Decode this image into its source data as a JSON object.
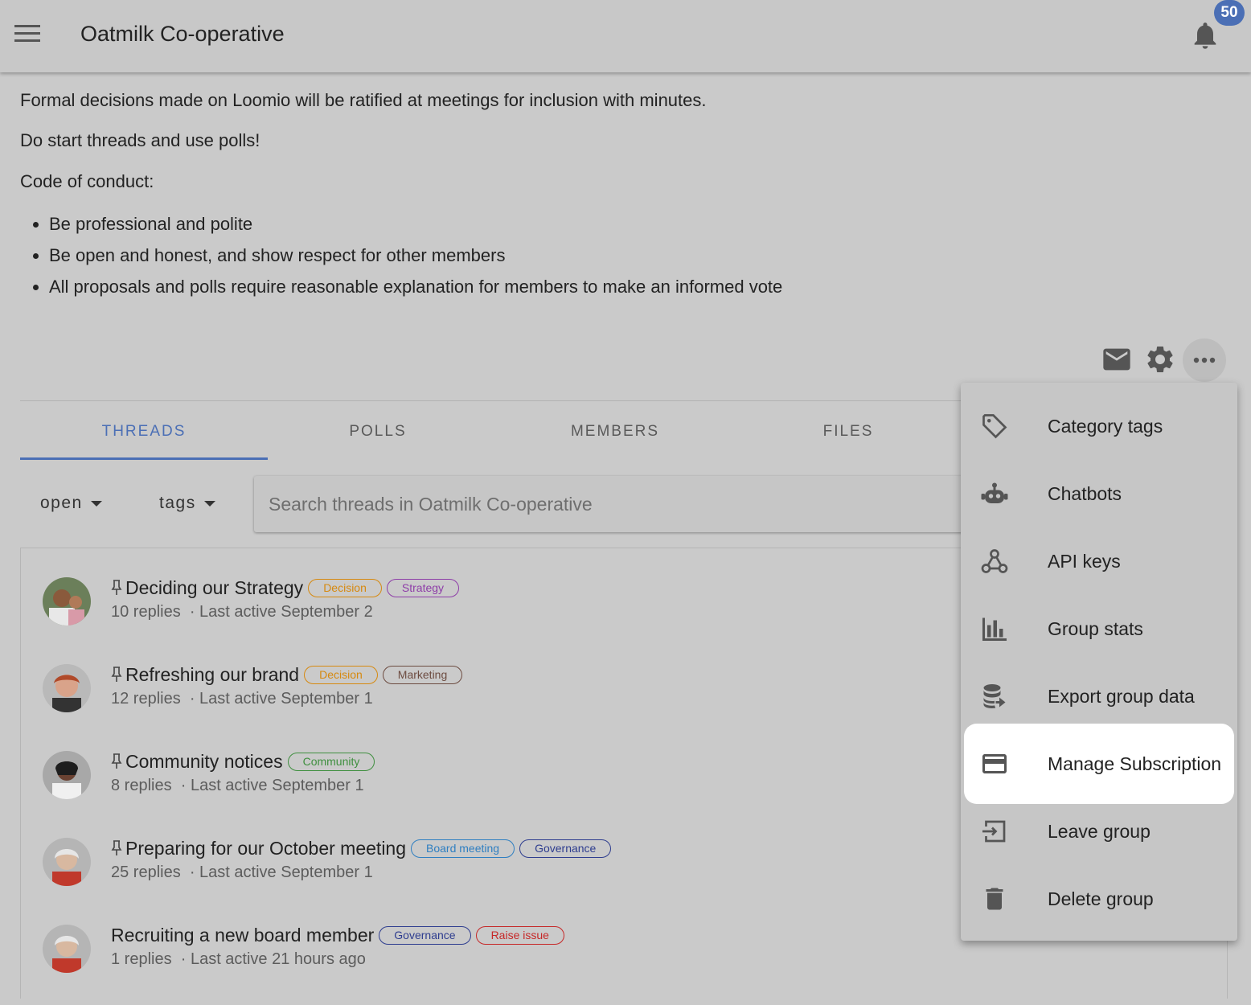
{
  "header": {
    "title": "Oatmilk Co-operative",
    "notification_count": "50"
  },
  "description": {
    "p1": "Formal decisions made on Loomio will be ratified at meetings for inclusion with minutes.",
    "p2": "Do start threads and use polls!",
    "p3": "Code of conduct:",
    "bullets": [
      "Be professional and polite",
      "Be open and honest, and show respect for other members",
      "All proposals and polls require reasonable explanation for members to make an informed vote"
    ]
  },
  "tabs": [
    "THREADS",
    "POLLS",
    "MEMBERS",
    "FILES"
  ],
  "filters": {
    "status": "open",
    "tags": "tags"
  },
  "search": {
    "placeholder": "Search threads in Oatmilk Co-operative"
  },
  "threads": [
    {
      "title": "Deciding our Strategy",
      "pinned": true,
      "tags": [
        {
          "label": "Decision",
          "color": "#d68910"
        },
        {
          "label": "Strategy",
          "color": "#8e3ea8"
        }
      ],
      "replies": "10 replies",
      "last_active": "· Last active September 2"
    },
    {
      "title": "Refreshing our brand",
      "pinned": true,
      "tags": [
        {
          "label": "Decision",
          "color": "#d68910"
        },
        {
          "label": "Marketing",
          "color": "#6d4c41"
        }
      ],
      "replies": "12 replies",
      "last_active": "· Last active September 1"
    },
    {
      "title": "Community notices",
      "pinned": true,
      "tags": [
        {
          "label": "Community",
          "color": "#3f8f3f"
        }
      ],
      "replies": "8 replies",
      "last_active": "· Last active September 1"
    },
    {
      "title": "Preparing for our October meeting",
      "pinned": true,
      "tags": [
        {
          "label": "Board meeting",
          "color": "#2f7fc1"
        },
        {
          "label": "Governance",
          "color": "#2e3d8f"
        }
      ],
      "replies": "25 replies",
      "last_active": "· Last active September 1"
    },
    {
      "title": "Recruiting a new board member",
      "pinned": false,
      "tags": [
        {
          "label": "Governance",
          "color": "#2e3d8f"
        },
        {
          "label": "Raise issue",
          "color": "#c62828"
        }
      ],
      "replies": "1 replies",
      "last_active": "· Last active 21 hours ago"
    }
  ],
  "menu": {
    "items": [
      {
        "label": "Category tags",
        "icon": "tag-icon"
      },
      {
        "label": "Chatbots",
        "icon": "robot-icon"
      },
      {
        "label": "API keys",
        "icon": "webhook-icon"
      },
      {
        "label": "Group stats",
        "icon": "bar-chart-icon"
      },
      {
        "label": "Export group data",
        "icon": "database-export-icon"
      },
      {
        "label": "Manage Subscription",
        "icon": "credit-card-icon",
        "highlighted": true
      },
      {
        "label": "Leave group",
        "icon": "exit-icon"
      },
      {
        "label": "Delete group",
        "icon": "trash-icon"
      }
    ]
  },
  "colors": {
    "accent": "#4b6fb5",
    "badge": "#4b6fb5"
  }
}
